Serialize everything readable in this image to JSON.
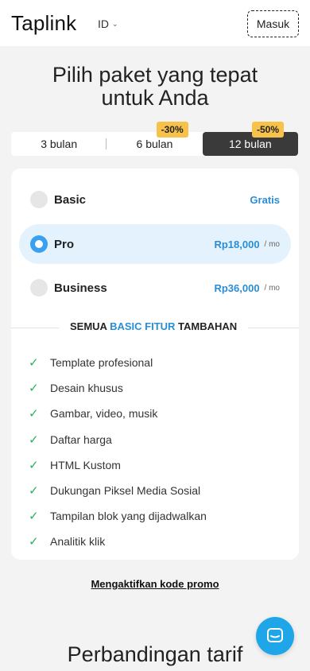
{
  "header": {
    "logo": "Taplink",
    "lang": "ID",
    "login_label": "Masuk"
  },
  "title_line1": "Pilih paket yang tepat",
  "title_line2": "untuk Anda",
  "periods": [
    {
      "label": "3 bulan",
      "badge": ""
    },
    {
      "label": "6 bulan",
      "badge": "-30%"
    },
    {
      "label": "12 bulan",
      "badge": "-50%"
    }
  ],
  "plans": [
    {
      "name": "Basic",
      "price": "Gratis",
      "per": ""
    },
    {
      "name": "Pro",
      "price": "Rp18,000",
      "per": "/ mo"
    },
    {
      "name": "Business",
      "price": "Rp36,000",
      "per": "/ mo"
    }
  ],
  "features_head": {
    "pre": "SEMUA ",
    "highlight": "BASIC FITUR",
    "post": " TAMBAHAN"
  },
  "features": [
    "Template profesional",
    "Desain khusus",
    "Gambar, video, musik",
    "Daftar harga",
    "HTML Kustom",
    "Dukungan Piksel Media Sosial",
    "Tampilan blok yang dijadwalkan",
    "Analitik klik"
  ],
  "promo_label": "Mengaktifkan kode promo",
  "compare_title": "Perbandingan tarif",
  "colors": {
    "accent": "#2a8ed6",
    "badge": "#f6c24a",
    "check": "#2eb05a",
    "chat": "#1fa6e8"
  }
}
